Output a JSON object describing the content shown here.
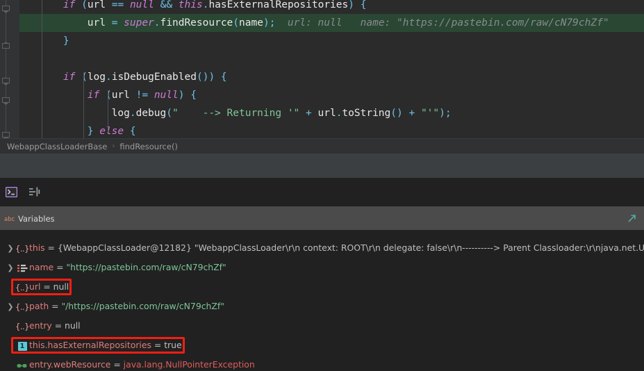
{
  "editor": {
    "lines": [
      {
        "indent": 4,
        "highlighted": false,
        "tokens": [
          {
            "t": "if",
            "c": "kw"
          },
          {
            "t": " ",
            "c": "pl"
          },
          {
            "t": "(",
            "c": "pn"
          },
          {
            "t": "url ",
            "c": "id"
          },
          {
            "t": "== ",
            "c": "pn"
          },
          {
            "t": "null",
            "c": "kw"
          },
          {
            "t": " ",
            "c": "pl"
          },
          {
            "t": "&&",
            "c": "pn"
          },
          {
            "t": " ",
            "c": "pl"
          },
          {
            "t": "this",
            "c": "kw"
          },
          {
            "t": ".",
            "c": "pn"
          },
          {
            "t": "hasExternalRepositories",
            "c": "id"
          },
          {
            "t": ")",
            "c": "pn"
          },
          {
            "t": " ",
            "c": "pl"
          },
          {
            "t": "{",
            "c": "pn"
          }
        ]
      },
      {
        "indent": 8,
        "highlighted": true,
        "tokens": [
          {
            "t": "url ",
            "c": "id"
          },
          {
            "t": "= ",
            "c": "pn"
          },
          {
            "t": "super",
            "c": "kw"
          },
          {
            "t": ".",
            "c": "pn"
          },
          {
            "t": "findResource",
            "c": "id"
          },
          {
            "t": "(",
            "c": "pn"
          },
          {
            "t": "name",
            "c": "id"
          },
          {
            "t": ")",
            "c": "pn"
          },
          {
            "t": ";",
            "c": "pn"
          },
          {
            "t": "  url: null   name: \"https://pastebin.com/raw/cN79chZf\"",
            "c": "hint"
          }
        ]
      },
      {
        "indent": 4,
        "highlighted": false,
        "tokens": [
          {
            "t": "}",
            "c": "pn"
          }
        ]
      },
      {
        "indent": 0,
        "highlighted": false,
        "tokens": []
      },
      {
        "indent": 4,
        "highlighted": false,
        "tokens": [
          {
            "t": "if",
            "c": "kw"
          },
          {
            "t": " ",
            "c": "pl"
          },
          {
            "t": "(",
            "c": "pn"
          },
          {
            "t": "log",
            "c": "id"
          },
          {
            "t": ".",
            "c": "pn"
          },
          {
            "t": "isDebugEnabled",
            "c": "id"
          },
          {
            "t": "()",
            "c": "pn"
          },
          {
            "t": ")",
            "c": "pn"
          },
          {
            "t": " ",
            "c": "pl"
          },
          {
            "t": "{",
            "c": "pn"
          }
        ]
      },
      {
        "indent": 8,
        "highlighted": false,
        "tokens": [
          {
            "t": "if",
            "c": "kw"
          },
          {
            "t": " ",
            "c": "pl"
          },
          {
            "t": "(",
            "c": "pn"
          },
          {
            "t": "url ",
            "c": "id"
          },
          {
            "t": "!= ",
            "c": "pn"
          },
          {
            "t": "null",
            "c": "kw"
          },
          {
            "t": ")",
            "c": "pn"
          },
          {
            "t": " ",
            "c": "pl"
          },
          {
            "t": "{",
            "c": "pn"
          }
        ]
      },
      {
        "indent": 12,
        "highlighted": false,
        "tokens": [
          {
            "t": "log",
            "c": "id"
          },
          {
            "t": ".",
            "c": "pn"
          },
          {
            "t": "debug",
            "c": "id"
          },
          {
            "t": "(",
            "c": "pn"
          },
          {
            "t": "\"    --> Returning '\"",
            "c": "str"
          },
          {
            "t": " + ",
            "c": "pn"
          },
          {
            "t": "url",
            "c": "id"
          },
          {
            "t": ".",
            "c": "pn"
          },
          {
            "t": "toString",
            "c": "id"
          },
          {
            "t": "()",
            "c": "pn"
          },
          {
            "t": " + ",
            "c": "pn"
          },
          {
            "t": "\"'\"",
            "c": "str"
          },
          {
            "t": ")",
            "c": "pn"
          },
          {
            "t": ";",
            "c": "pn"
          }
        ]
      },
      {
        "indent": 8,
        "highlighted": false,
        "tokens": [
          {
            "t": "}",
            "c": "pn"
          },
          {
            "t": " ",
            "c": "pl"
          },
          {
            "t": "else",
            "c": "kw"
          },
          {
            "t": " ",
            "c": "pl"
          },
          {
            "t": "{",
            "c": "pn"
          }
        ]
      }
    ]
  },
  "breadcrumb": {
    "class_name": "WebappClassLoaderBase",
    "separator": "›",
    "method_name": "findResource()"
  },
  "toolbar": {
    "console_button_label": "Console",
    "console_icon": "console-icon",
    "filter_button_label": "Filter",
    "filter_icon": "filter-lines-icon"
  },
  "variables_panel": {
    "header_icon": "abc-icon",
    "header_icon_text": "abc",
    "title": "Variables",
    "expand_icon": "expand-arrow-icon",
    "rows": [
      {
        "expandable": true,
        "icon": "object-braces-icon",
        "icon_text": "{..}",
        "icon_kind": "obj",
        "name": "this",
        "equals": " = ",
        "value": "{WebappClassLoader@12182} \"WebappClassLoader\\r\\n  context: ROOT\\r\\n  delegate: false\\r\\n----------> Parent Classloader:\\r\\njava.net.U",
        "value_kind": "plain",
        "annotated": false
      },
      {
        "expandable": true,
        "icon": "string-list-icon",
        "icon_text": "",
        "icon_kind": "str",
        "name": "name",
        "equals": " = ",
        "value": "\"https://pastebin.com/raw/cN79chZf\"",
        "value_kind": "string",
        "annotated": false
      },
      {
        "expandable": false,
        "icon": "object-braces-icon",
        "icon_text": "{..}",
        "icon_kind": "obj",
        "name": "url",
        "equals": " = ",
        "value": "null",
        "value_kind": "plain",
        "annotated": true
      },
      {
        "expandable": true,
        "icon": "object-braces-icon",
        "icon_text": "{..}",
        "icon_kind": "obj",
        "name": "path",
        "equals": " = ",
        "value": "\"/https://pastebin.com/raw/cN79chZf\"",
        "value_kind": "string",
        "annotated": false
      },
      {
        "expandable": false,
        "icon": "object-braces-icon",
        "icon_text": "{..}",
        "icon_kind": "obj",
        "name": "entry",
        "equals": " = ",
        "value": "null",
        "value_kind": "plain",
        "annotated": false
      },
      {
        "expandable": false,
        "icon": "boolean-field-icon",
        "icon_text": "1",
        "icon_kind": "bool",
        "name": "this.hasExternalRepositories",
        "equals": " = ",
        "value": "true",
        "value_kind": "plain",
        "annotated": true
      },
      {
        "expandable": false,
        "icon": "watch-glasses-icon",
        "icon_text": "",
        "icon_kind": "watch",
        "name": "entry.webResource",
        "equals": " = ",
        "value": "java.lang.NullPointerException",
        "value_kind": "error",
        "annotated": false
      }
    ]
  },
  "colors": {
    "editor_bg": "#2b2b2b",
    "exec_line_bg": "#2a4733",
    "panel_bg": "#212121",
    "header_bg": "#4b4b4b",
    "annotation_red": "#f21f13",
    "accent_teal": "#5ec8d8",
    "keyword_purple": "#cc7bd6",
    "string_green": "#7ec699",
    "var_name_red": "#e27b7b"
  }
}
